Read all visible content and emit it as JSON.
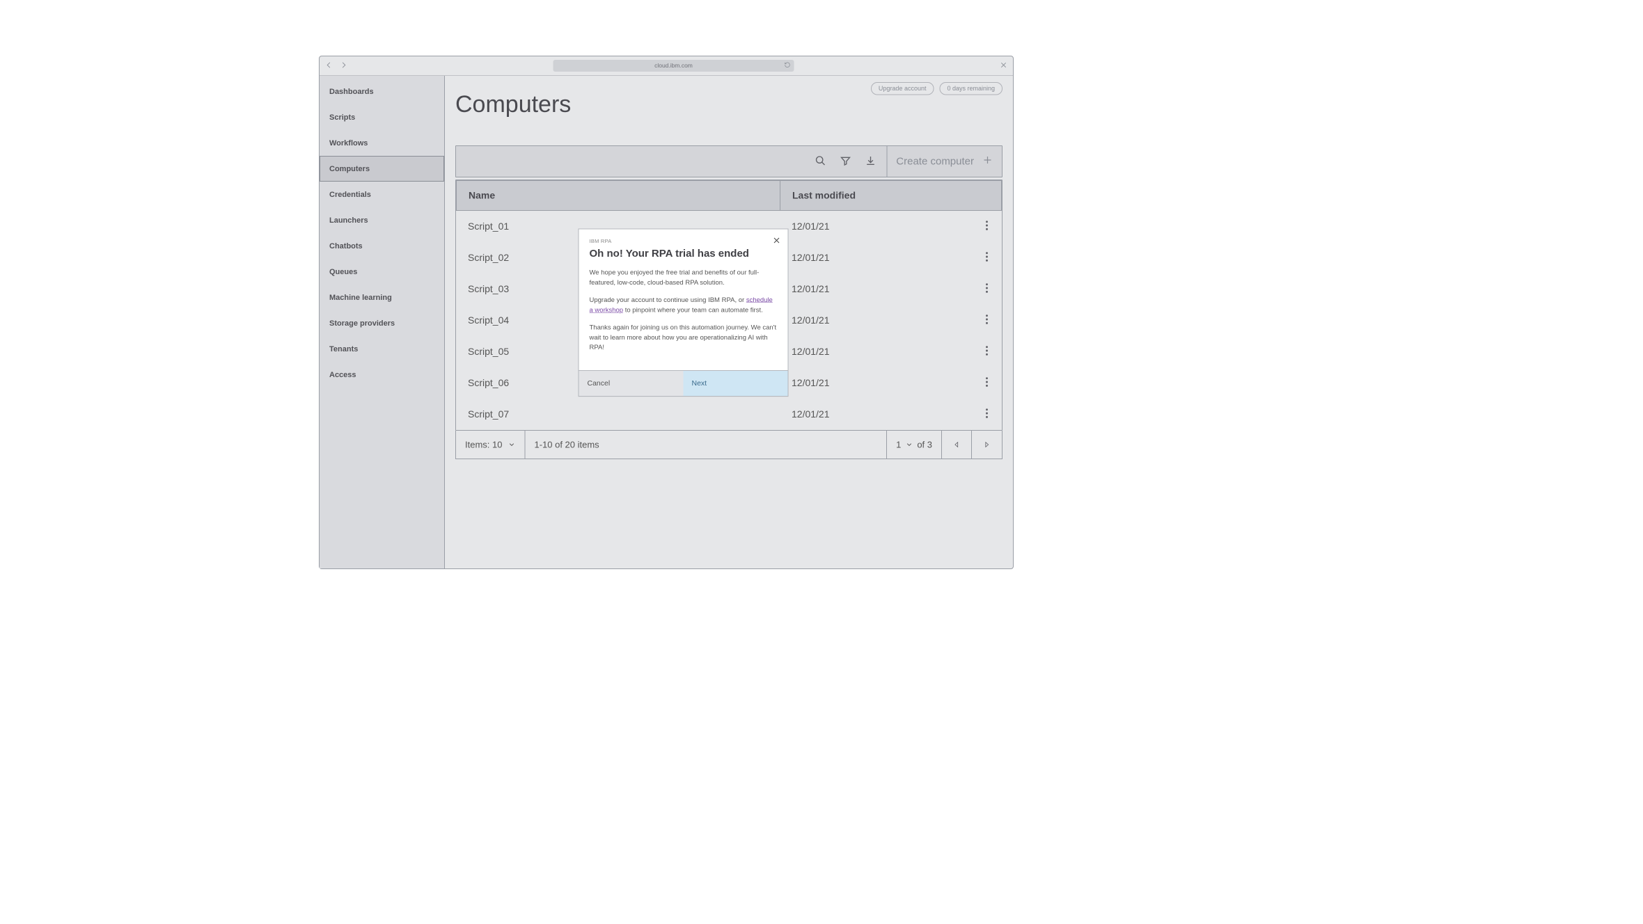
{
  "browser": {
    "url": "cloud.ibm.com"
  },
  "header": {
    "upgrade_label": "Upgrade account",
    "days_remaining_label": "0 days remaining"
  },
  "page": {
    "title": "Computers"
  },
  "sidebar": {
    "items": [
      {
        "label": "Dashboards"
      },
      {
        "label": "Scripts"
      },
      {
        "label": "Workflows"
      },
      {
        "label": "Computers"
      },
      {
        "label": "Credentials"
      },
      {
        "label": "Launchers"
      },
      {
        "label": "Chatbots"
      },
      {
        "label": "Queues"
      },
      {
        "label": "Machine learning"
      },
      {
        "label": "Storage providers"
      },
      {
        "label": "Tenants"
      },
      {
        "label": "Access"
      }
    ],
    "active_index": 3
  },
  "toolbar": {
    "create_label": "Create computer"
  },
  "table": {
    "columns": {
      "name": "Name",
      "last_modified": "Last modified"
    },
    "rows": [
      {
        "name": "Script_01",
        "last_modified": "12/01/21"
      },
      {
        "name": "Script_02",
        "last_modified": "12/01/21"
      },
      {
        "name": "Script_03",
        "last_modified": "12/01/21"
      },
      {
        "name": "Script_04",
        "last_modified": "12/01/21"
      },
      {
        "name": "Script_05",
        "last_modified": "12/01/21"
      },
      {
        "name": "Script_06",
        "last_modified": "12/01/21"
      },
      {
        "name": "Script_07",
        "last_modified": "12/01/21"
      }
    ]
  },
  "pager": {
    "items_label": "Items: 10",
    "range_label": "1-10 of 20 items",
    "page_current": "1",
    "page_of": "of 3"
  },
  "modal": {
    "eyebrow": "IBM RPA",
    "title": "Oh no! Your RPA trial has ended",
    "body1": "We hope you enjoyed the free trial and benefits of our full-featured, low-code, cloud-based RPA solution.",
    "body2a": "Upgrade your account to continue using IBM RPA, or ",
    "body2_link": "schedule a workshop",
    "body2b": " to pinpoint where your team can automate first.",
    "body3": "Thanks again for joining us on this automation journey. We can't wait to learn more about how you are operationalizing AI with RPA!",
    "cancel_label": "Cancel",
    "next_label": "Next"
  }
}
